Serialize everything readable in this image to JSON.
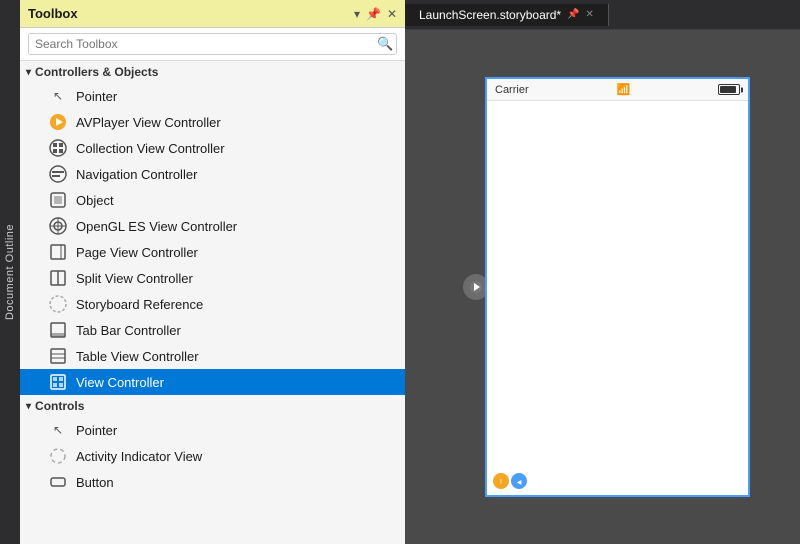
{
  "doc_outline": {
    "label": "Document Outline"
  },
  "toolbox": {
    "title": "Toolbox",
    "search_placeholder": "Search Toolbox",
    "header_icons": [
      "▼",
      "📌",
      "✕"
    ],
    "sections": [
      {
        "id": "controllers",
        "label": "Controllers & Objects",
        "expanded": true,
        "items": [
          {
            "id": "pointer1",
            "label": "Pointer",
            "icon": "cursor"
          },
          {
            "id": "avplayer",
            "label": "AVPlayer View Controller",
            "icon": "avplayer"
          },
          {
            "id": "collection",
            "label": "Collection View Controller",
            "icon": "collection"
          },
          {
            "id": "navigation",
            "label": "Navigation Controller",
            "icon": "navigation"
          },
          {
            "id": "object",
            "label": "Object",
            "icon": "object"
          },
          {
            "id": "opengl",
            "label": "OpenGL ES View Controller",
            "icon": "opengl"
          },
          {
            "id": "page",
            "label": "Page View Controller",
            "icon": "page"
          },
          {
            "id": "split",
            "label": "Split View Controller",
            "icon": "split"
          },
          {
            "id": "storyboard",
            "label": "Storyboard Reference",
            "icon": "storyboard"
          },
          {
            "id": "tabbar",
            "label": "Tab Bar Controller",
            "icon": "tabbar"
          },
          {
            "id": "tableview",
            "label": "Table View Controller",
            "icon": "tableview"
          },
          {
            "id": "viewcontroller",
            "label": "View Controller",
            "icon": "viewcontroller",
            "selected": true
          }
        ]
      },
      {
        "id": "controls",
        "label": "Controls",
        "expanded": true,
        "items": [
          {
            "id": "pointer2",
            "label": "Pointer",
            "icon": "cursor2"
          },
          {
            "id": "activity",
            "label": "Activity Indicator View",
            "icon": "activity"
          },
          {
            "id": "button",
            "label": "Button",
            "icon": "button"
          }
        ]
      }
    ]
  },
  "editor": {
    "tab_label": "LaunchScreen.storyboard*",
    "tab_modified": true,
    "status_bar": {
      "carrier": "Carrier",
      "signal": "▾"
    },
    "bottom_icons": [
      "☀",
      "◀"
    ]
  },
  "colors": {
    "accent": "#0078d7",
    "tab_active_bg": "#1e1e1e",
    "tab_bar_bg": "#2d2d30",
    "toolbox_header_bg": "#f0f0a0",
    "selected_item_bg": "#0078d7",
    "phone_border": "#4a9eff"
  }
}
